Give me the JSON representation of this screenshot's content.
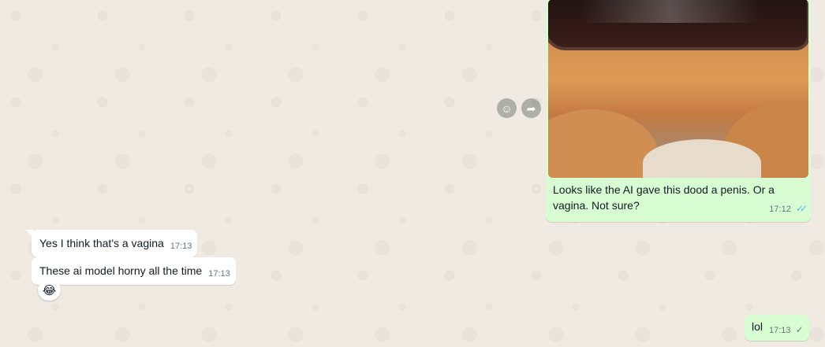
{
  "messages": {
    "image_message": {
      "caption": "Looks like the AI gave this dood a penis. Or a vagina. Not sure?",
      "time": "17:12",
      "status": "read"
    },
    "incoming_1": {
      "text": "Yes I think that's a vagina",
      "time": "17:13"
    },
    "incoming_2": {
      "text": "These ai model horny all the time",
      "time": "17:13",
      "reaction": "😂"
    },
    "outgoing_lol": {
      "text": "lol",
      "time": "17:13",
      "status": "sent"
    }
  },
  "icons": {
    "hover": [
      "emoji-react-icon",
      "forward-icon"
    ],
    "read_tick": "✓✓",
    "sent_tick": "✓"
  },
  "colors": {
    "outgoing_bubble": "#d9fdd3",
    "incoming_bubble": "#ffffff",
    "read_tick": "#53bdeb",
    "background": "#efeae2"
  }
}
